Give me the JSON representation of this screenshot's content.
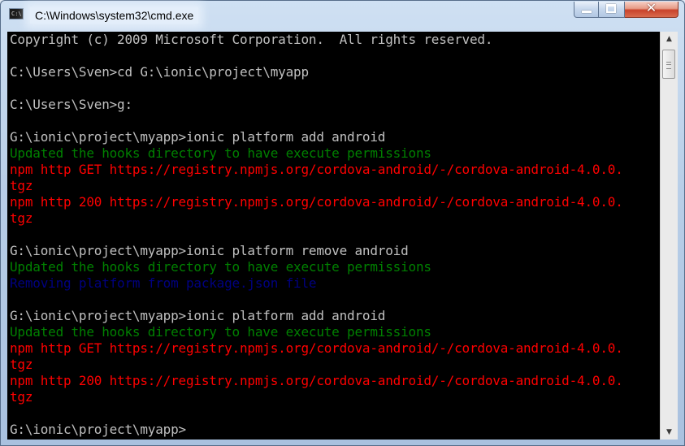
{
  "window": {
    "title": "C:\\Windows\\system32\\cmd.exe",
    "icon": "cmd-icon",
    "controls": {
      "minimize": "minimize-icon",
      "maximize": "maximize-icon",
      "close": "close-icon"
    }
  },
  "colors": {
    "default_text": "#c0c0c0",
    "green": "#008000",
    "red": "#ff0000",
    "blue": "#000080",
    "background": "#000000"
  },
  "console": {
    "lines": [
      {
        "text": "Copyright (c) 2009 Microsoft Corporation.  All rights reserved.",
        "color": "white"
      },
      {
        "text": "",
        "color": "white"
      },
      {
        "text": "C:\\Users\\Sven>cd G:\\ionic\\project\\myapp",
        "color": "white"
      },
      {
        "text": "",
        "color": "white"
      },
      {
        "text": "C:\\Users\\Sven>g:",
        "color": "white"
      },
      {
        "text": "",
        "color": "white"
      },
      {
        "text": "G:\\ionic\\project\\myapp>ionic platform add android",
        "color": "white"
      },
      {
        "text": "Updated the hooks directory to have execute permissions",
        "color": "green"
      },
      {
        "text": "npm http GET https://registry.npmjs.org/cordova-android/-/cordova-android-4.0.0.",
        "color": "red"
      },
      {
        "text": "tgz",
        "color": "red"
      },
      {
        "text": "npm http 200 https://registry.npmjs.org/cordova-android/-/cordova-android-4.0.0.",
        "color": "red"
      },
      {
        "text": "tgz",
        "color": "red"
      },
      {
        "text": "",
        "color": "white"
      },
      {
        "text": "G:\\ionic\\project\\myapp>ionic platform remove android",
        "color": "white"
      },
      {
        "text": "Updated the hooks directory to have execute permissions",
        "color": "green"
      },
      {
        "text": "Removing platform from package.json file",
        "color": "blue"
      },
      {
        "text": "",
        "color": "white"
      },
      {
        "text": "G:\\ionic\\project\\myapp>ionic platform add android",
        "color": "white"
      },
      {
        "text": "Updated the hooks directory to have execute permissions",
        "color": "green"
      },
      {
        "text": "npm http GET https://registry.npmjs.org/cordova-android/-/cordova-android-4.0.0.",
        "color": "red"
      },
      {
        "text": "tgz",
        "color": "red"
      },
      {
        "text": "npm http 200 https://registry.npmjs.org/cordova-android/-/cordova-android-4.0.0.",
        "color": "red"
      },
      {
        "text": "tgz",
        "color": "red"
      },
      {
        "text": "",
        "color": "white"
      },
      {
        "text": "G:\\ionic\\project\\myapp>",
        "color": "white"
      }
    ]
  },
  "scrollbar": {
    "up_icon": "scroll-up-arrow-icon",
    "down_icon": "scroll-down-arrow-icon",
    "thumb_position": 0.0
  }
}
